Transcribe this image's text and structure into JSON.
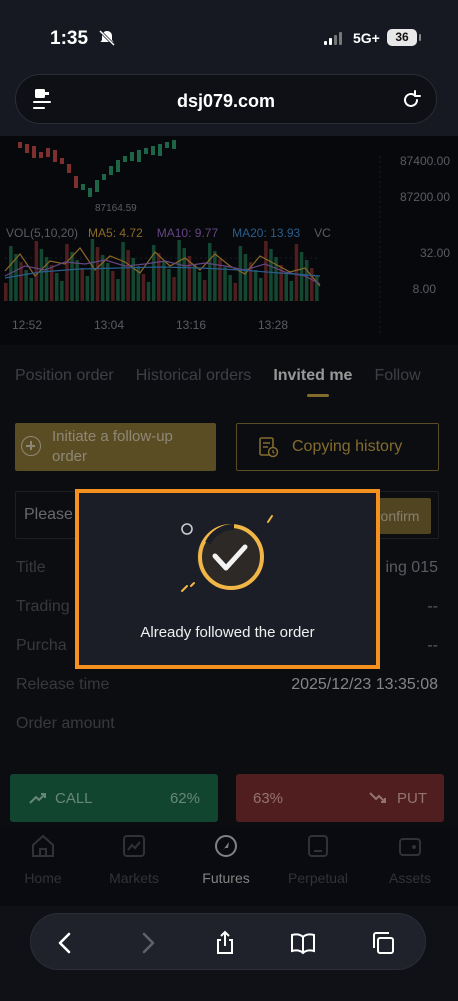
{
  "status_bar": {
    "time": "1:35",
    "network": "5G+",
    "battery": "36"
  },
  "browser": {
    "url": "dsj079.com"
  },
  "chart": {
    "price_labels": [
      "87400.00",
      "87200.00"
    ],
    "low_label": "87164.59",
    "indicators": [
      {
        "label": "VOL(5,10,20)",
        "color": "#8a8d96"
      },
      {
        "label": "MA5: 4.72",
        "color": "#d6a13b"
      },
      {
        "label": "MA10: 9.77",
        "color": "#9a6bc7"
      },
      {
        "label": "MA20: 13.93",
        "color": "#3f8fd6"
      },
      {
        "label": "VC",
        "color": "#8a8d96"
      }
    ],
    "vol_labels": [
      "32.00",
      "8.00"
    ],
    "time_labels": [
      "12:52",
      "13:04",
      "13:16",
      "13:28"
    ]
  },
  "tabs": [
    "Position order",
    "Historical orders",
    "Invited me",
    "Follow"
  ],
  "active_tab": "Invited me",
  "actions": {
    "follow_up": "Initiate a follow-up order",
    "follow_up_line1": "Initiate a follow-up",
    "follow_up_line2": "order",
    "history": "Copying history"
  },
  "search": {
    "placeholder": "Please",
    "confirm": "onfirm"
  },
  "details": [
    {
      "label": "Title",
      "value": "ing 015"
    },
    {
      "label": "Trading",
      "value": "--"
    },
    {
      "label": "Purcha",
      "value": "--"
    },
    {
      "label": "Release time",
      "value": "2025/12/23 13:35:08"
    },
    {
      "label": "Order amount",
      "value": ""
    }
  ],
  "trade": {
    "call_label": "CALL",
    "call_pct": "62%",
    "put_label": "PUT",
    "put_pct": "63%"
  },
  "nav": [
    "Home",
    "Markets",
    "Futures",
    "Perpetual",
    "Assets"
  ],
  "active_nav": "Futures",
  "modal": {
    "message": "Already followed the order"
  },
  "colors": {
    "accent": "#c9a548",
    "modal_border": "#f5921f",
    "call": "#1b6a4a",
    "put": "#7c2f2e"
  }
}
